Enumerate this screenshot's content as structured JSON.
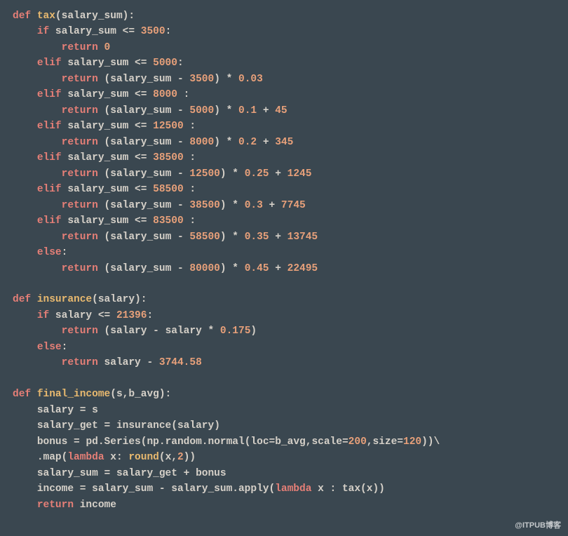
{
  "code": {
    "fn1_def": "def",
    "fn1_name": "tax",
    "fn1_param": "salary_sum",
    "if": "if",
    "elif": "elif",
    "else": "else",
    "return": "return",
    "lambda": "lambda",
    "fn2_def": "def",
    "fn2_name": "insurance",
    "fn2_param": "salary",
    "fn3_def": "def",
    "fn3_name": "final_income",
    "fn3_param1": "s",
    "fn3_param2": "b_avg",
    "salary": "salary",
    "salary_get": "salary_get",
    "salary_sum": "salary_sum",
    "bonus": "bonus",
    "income": "income",
    "pd": "pd",
    "Series": "Series",
    "np": "np",
    "random": "random",
    "normal": "normal",
    "loc": "loc",
    "scale": "scale",
    "size": "size",
    "map": "map",
    "apply": "apply",
    "round": "round",
    "x": "x",
    "n0": "0",
    "n3500": "3500",
    "n5000": "5000",
    "n0_03": "0.03",
    "n8000": "8000",
    "n0_1": "0.1",
    "n45": "45",
    "n12500": "12500",
    "n0_2": "0.2",
    "n345": "345",
    "n38500": "38500",
    "n0_25": "0.25",
    "n1245": "1245",
    "n58500": "58500",
    "n0_3": "0.3",
    "n7745": "7745",
    "n83500": "83500",
    "n0_35": "0.35",
    "n13745": "13745",
    "n80000": "80000",
    "n0_45": "0.45",
    "n22495": "22495",
    "n21396": "21396",
    "n0_175": "0.175",
    "n3744_58": "3744.58",
    "n200": "200",
    "n120": "120",
    "n2": "2"
  },
  "watermark": "@ITPUB博客"
}
